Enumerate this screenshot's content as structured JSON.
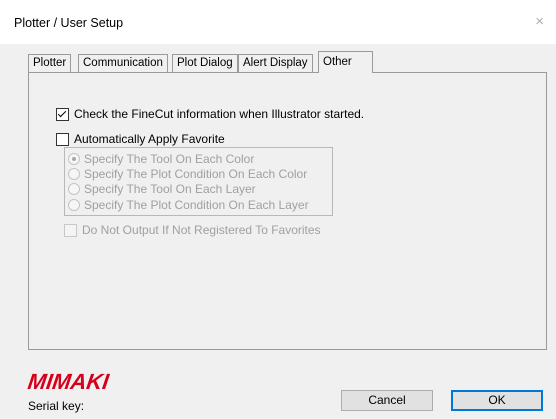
{
  "window": {
    "title": "Plotter / User Setup",
    "close_glyph": "×"
  },
  "tabs": [
    {
      "label": "Plotter"
    },
    {
      "label": "Communication"
    },
    {
      "label": "Plot Dialog"
    },
    {
      "label": "Alert Display"
    },
    {
      "label": "Other",
      "active": true
    }
  ],
  "other_tab": {
    "check_finecut": {
      "label": "Check the FineCut information when Illustrator started.",
      "checked": true
    },
    "auto_apply_favorite": {
      "label": "Automatically Apply Favorite",
      "checked": false
    },
    "favorite_options": [
      {
        "label": "Specify The Tool On Each Color",
        "selected": true
      },
      {
        "label": "Specify The Plot Condition On Each Color",
        "selected": false
      },
      {
        "label": "Specify The Tool On Each Layer",
        "selected": false
      },
      {
        "label": "Specify The Plot Condition On Each Layer",
        "selected": false
      }
    ],
    "do_not_output": {
      "label": "Do Not Output If Not Registered To Favorites",
      "checked": false,
      "enabled": false
    }
  },
  "footer": {
    "logo_text": "Mimaki",
    "serial_label": "Serial key:",
    "cancel_label": "Cancel",
    "ok_label": "OK"
  },
  "colors": {
    "brand_red": "#d6001c",
    "focus_blue": "#0078d7"
  }
}
